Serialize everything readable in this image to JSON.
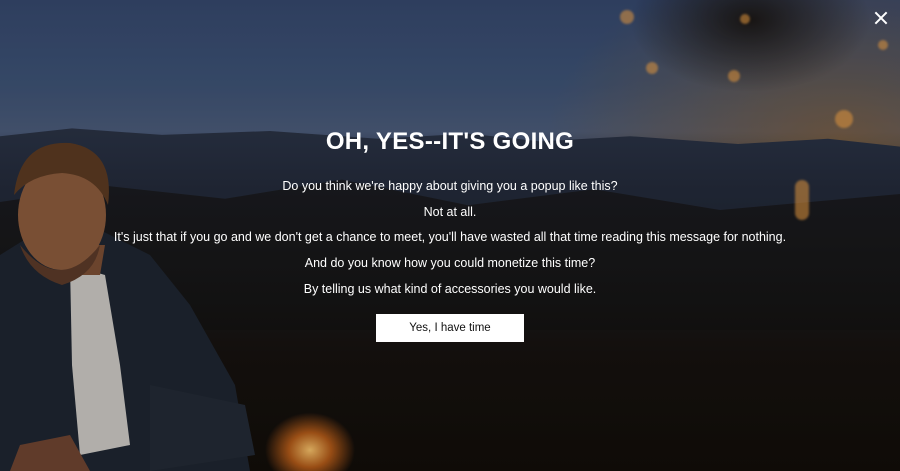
{
  "popup": {
    "title": "OH, YES--IT'S GOING",
    "lines": [
      "Do you think we're happy about giving you a popup like this?",
      "Not at all.",
      "It's just that if you go and we don't get a chance to meet, you'll have wasted all that time reading this message for nothing.",
      "And do you know how you could monetize this time?",
      "By telling us what kind of accessories you would like."
    ],
    "cta_label": "Yes, I have time",
    "close_icon": "close-icon"
  }
}
